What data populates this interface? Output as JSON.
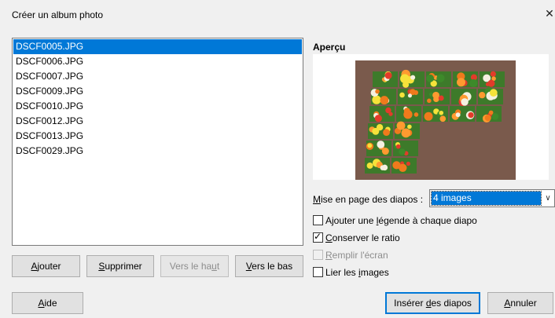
{
  "dialog": {
    "title": "Créer un album photo",
    "close_glyph": "✕"
  },
  "file_list": {
    "items": [
      "DSCF0005.JPG",
      "DSCF0006.JPG",
      "DSCF0007.JPG",
      "DSCF0009.JPG",
      "DSCF0010.JPG",
      "DSCF0012.JPG",
      "DSCF0013.JPG",
      "DSCF0029.JPG"
    ],
    "selected_index": 0
  },
  "list_buttons": {
    "add": {
      "pre": "",
      "mnemonic": "A",
      "post": "jouter"
    },
    "remove": {
      "pre": "",
      "mnemonic": "S",
      "post": "upprimer"
    },
    "up": {
      "pre": "Vers le ha",
      "mnemonic": "u",
      "post": "t"
    },
    "down": {
      "pre": "",
      "mnemonic": "V",
      "post": "ers le bas"
    }
  },
  "preview": {
    "label": "Aperçu"
  },
  "layout": {
    "label_pre": "",
    "label_mnemonic": "M",
    "label_post": "ise en page des diapos :",
    "selected_value": "4 images",
    "arrow_glyph": "∨"
  },
  "options": {
    "caption": {
      "pre": "Ajouter une ",
      "mnemonic": "l",
      "post": "égende à chaque diapo",
      "checked": false
    },
    "ratio": {
      "pre": "",
      "mnemonic": "C",
      "post": "onserver le ratio",
      "checked": true
    },
    "fill": {
      "pre": "",
      "mnemonic": "R",
      "post": "emplir l'écran",
      "checked": false
    },
    "link": {
      "pre": "Lier les ",
      "mnemonic": "i",
      "post": "mages",
      "checked": false
    }
  },
  "footer": {
    "help": {
      "pre": "",
      "mnemonic": "A",
      "post": "ide"
    },
    "insert": {
      "pre": "Insérer ",
      "mnemonic": "d",
      "post": "es diapos"
    },
    "cancel": {
      "pre": "",
      "mnemonic": "A",
      "post": "nnuler"
    }
  },
  "colors": {
    "selection": "#0078d7",
    "dialog_bg": "#f0f0f0"
  }
}
